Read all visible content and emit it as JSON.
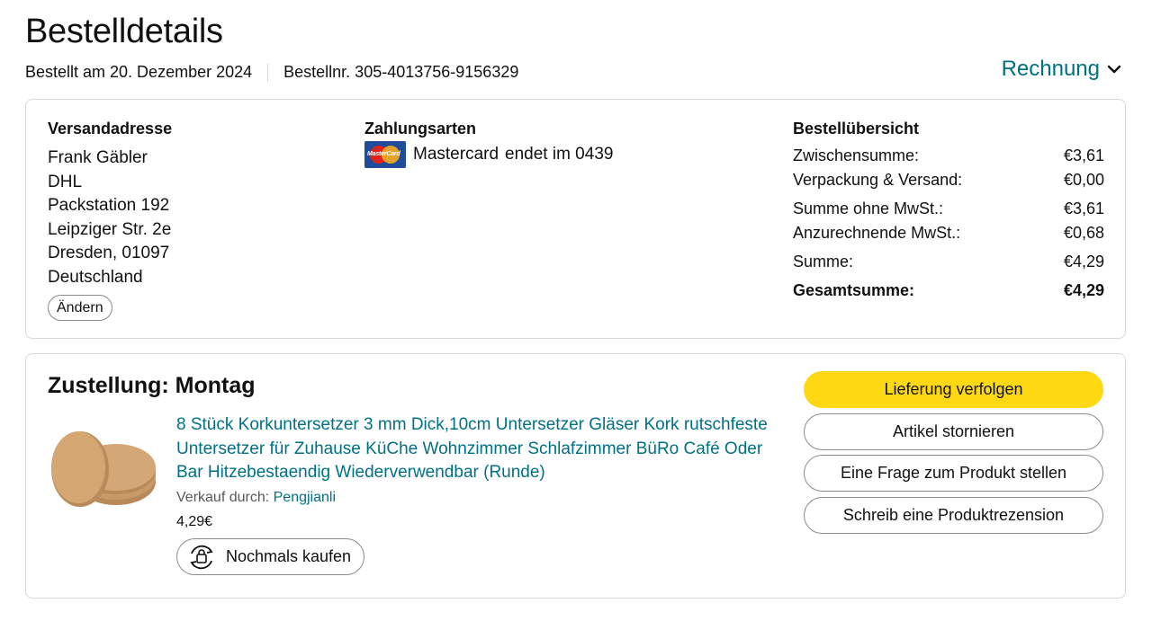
{
  "header": {
    "title": "Bestelldetails",
    "order_date": "Bestellt am 20. Dezember 2024",
    "order_number": "Bestellnr. 305-4013756-9156329",
    "invoice_label": "Rechnung"
  },
  "shipping": {
    "heading": "Versandadresse",
    "lines": [
      "Frank Gäbler",
      "DHL",
      "Packstation 192",
      "Leipziger Str. 2e",
      "Dresden, 01097",
      "Deutschland"
    ],
    "change_label": "Ändern"
  },
  "payment": {
    "heading": "Zahlungsarten",
    "card_name": "Mastercard",
    "card_ending": "endet im 0439",
    "card_icon": "mastercard-icon",
    "card_logo_text": "MasterCard"
  },
  "summary": {
    "heading": "Bestellübersicht",
    "rows": [
      {
        "label": "Zwischensumme:",
        "value": "€3,61"
      },
      {
        "label": "Verpackung & Versand:",
        "value": "€0,00"
      },
      {
        "label": "Summe ohne MwSt.:",
        "value": "€3,61"
      },
      {
        "label": "Anzurechnende MwSt.:",
        "value": "€0,68"
      },
      {
        "label": "Summe:",
        "value": "€4,29"
      },
      {
        "label": "Gesamtsumme:",
        "value": "€4,29"
      }
    ]
  },
  "delivery": {
    "title": "Zustellung: Montag",
    "product_title": "8 Stück Korkuntersetzer 3 mm Dick,10cm Untersetzer Gläser Kork rutschfeste Untersetzer für Zuhause KüChe Wohnzimmer Schlafzimmer BüRo Café Oder Bar Hitzebestaendig Wiederverwendbar (Runde)",
    "seller_prefix": "Verkauf durch: ",
    "seller_name": "Pengjianli",
    "price": "4,29€",
    "buy_again_label": "Nochmals kaufen",
    "actions": [
      {
        "label": "Lieferung verfolgen"
      },
      {
        "label": "Artikel stornieren"
      },
      {
        "label": "Eine Frage zum Produkt stellen"
      },
      {
        "label": "Schreib eine Produktrezension"
      }
    ]
  },
  "colors": {
    "link": "#007185",
    "primary_button": "#ffd814",
    "border": "#d5d9d9",
    "text": "#0f1111"
  }
}
